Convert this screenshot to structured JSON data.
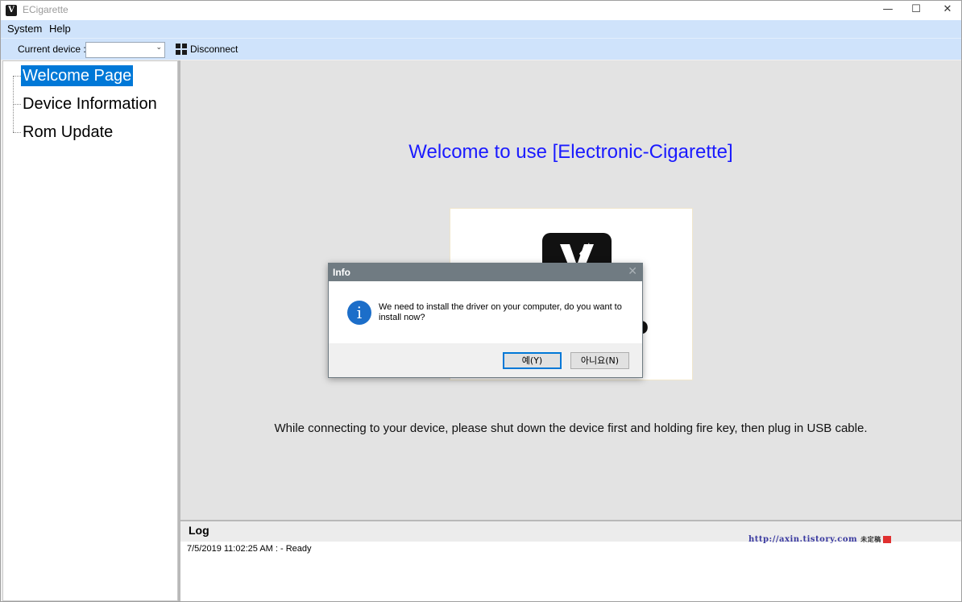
{
  "window": {
    "title": "ECigarette",
    "app_icon_glyph": "V",
    "minimize_glyph": "—",
    "maximize_glyph": "☐",
    "close_glyph": "✕"
  },
  "menu": {
    "items": [
      "System",
      "Help"
    ]
  },
  "toolbar": {
    "device_label": "Current device :",
    "device_value": "",
    "disconnect_label": "Disconnect"
  },
  "tree": {
    "items": [
      "Welcome Page",
      "Device Information",
      "Rom Update"
    ],
    "selected": "Welcome Page"
  },
  "content": {
    "welcome_text": "Welcome to use [Electronic-Cigarette]",
    "logo_partial_text": "o",
    "hint_text": "While connecting to your device, please shut down the device first and holding fire key, then plug in USB cable."
  },
  "log": {
    "title": "Log",
    "lines": [
      "7/5/2019 11:02:25 AM  :  - Ready"
    ],
    "watermark": "http://axin.tistory.com",
    "watermark_tail": "未定稿"
  },
  "dialog": {
    "title": "Info",
    "close_glyph": "✕",
    "icon_glyph": "i",
    "message": "We need to install the driver on your computer, do you want to install now?",
    "yes_label": "예(Y)",
    "no_label": "아니요(N)"
  },
  "colors": {
    "accent": "#0078d7",
    "menubar": "#cfe3fb",
    "welcome_text": "#1a1aff"
  }
}
